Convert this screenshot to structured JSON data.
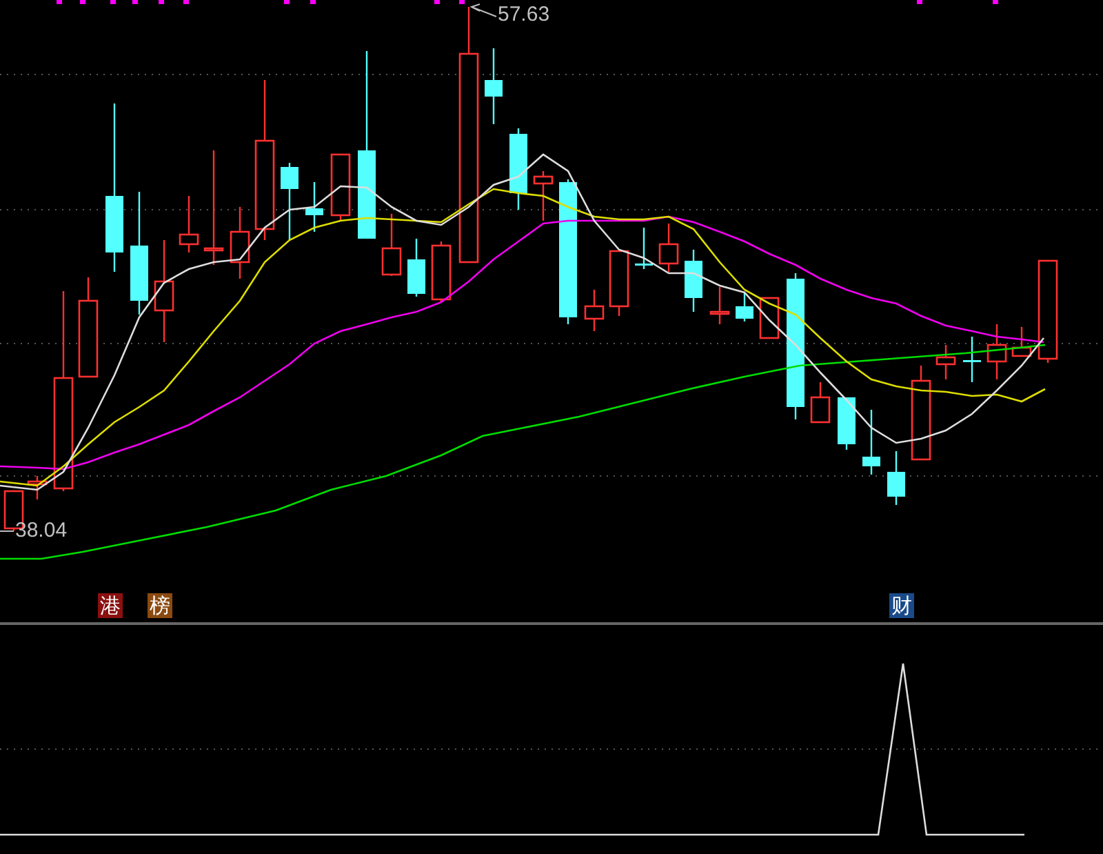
{
  "price_labels": [
    {
      "text": "57.63"
    },
    {
      "text": "38.04"
    }
  ],
  "event_tags": [
    {
      "label": "港",
      "color": "#8b1010"
    },
    {
      "label": "榜",
      "color": "#8b4a10"
    },
    {
      "label": "财",
      "color": "#1a4a8a"
    }
  ]
}
